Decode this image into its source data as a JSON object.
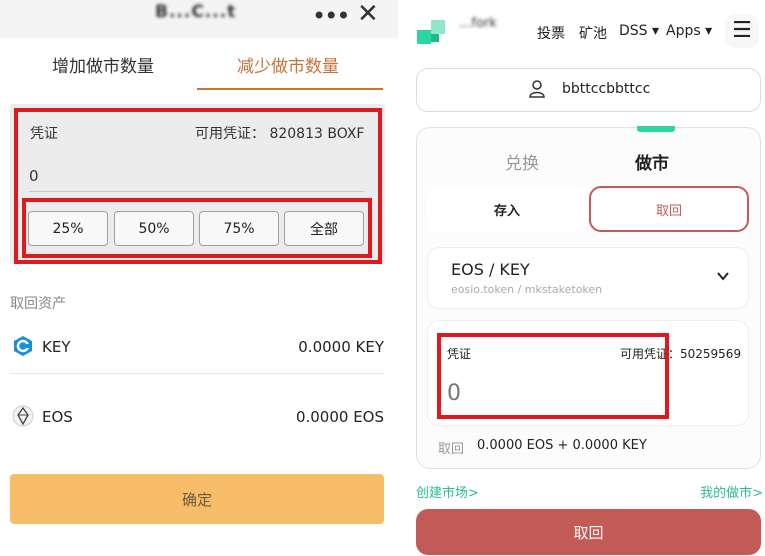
{
  "left": {
    "app_title": "B...C...t",
    "tabs": [
      "增加做市数量",
      "减少做市数量"
    ],
    "active_tab": 1,
    "credential": {
      "label": "凭证",
      "available_label": "可用凭证：",
      "available_value": "820813 BOXF",
      "input_value": "0"
    },
    "percent_buttons": [
      "25%",
      "50%",
      "75%",
      "全部"
    ],
    "withdraw_section_title": "取回资产",
    "assets": [
      {
        "icon": "key-token-icon",
        "name": "KEY",
        "amount": "0.0000 KEY"
      },
      {
        "icon": "eos-token-icon",
        "name": "EOS",
        "amount": "0.0000 EOS"
      }
    ],
    "confirm_label": "确定",
    "colors": {
      "accent": "#c8733a",
      "confirm": "#f7bd68",
      "highlight": "#e0191f"
    }
  },
  "right": {
    "brand": "...fork",
    "nav": [
      "投票",
      "矿池",
      "DSS ▾",
      "Apps ▾"
    ],
    "account": "bbttccbbttcc",
    "mode_tabs": [
      "兑换",
      "做市"
    ],
    "active_mode": 1,
    "actions": {
      "deposit": "存入",
      "withdraw": "取回"
    },
    "pair": {
      "name": "EOS / KEY",
      "contract": "eosio.token / mkstaketoken"
    },
    "credential": {
      "label": "凭证",
      "available": "可用凭证：50259569",
      "input_placeholder": "0"
    },
    "withdraw_label": "取回",
    "withdraw_amount": "0.0000 EOS + 0.0000 KEY",
    "links": {
      "create_market": "创建市场>",
      "my_markets": "我的做市>"
    },
    "submit_label": "取回",
    "colors": {
      "brand_green": "#2dd6a0",
      "primary": "#c25b55"
    }
  }
}
